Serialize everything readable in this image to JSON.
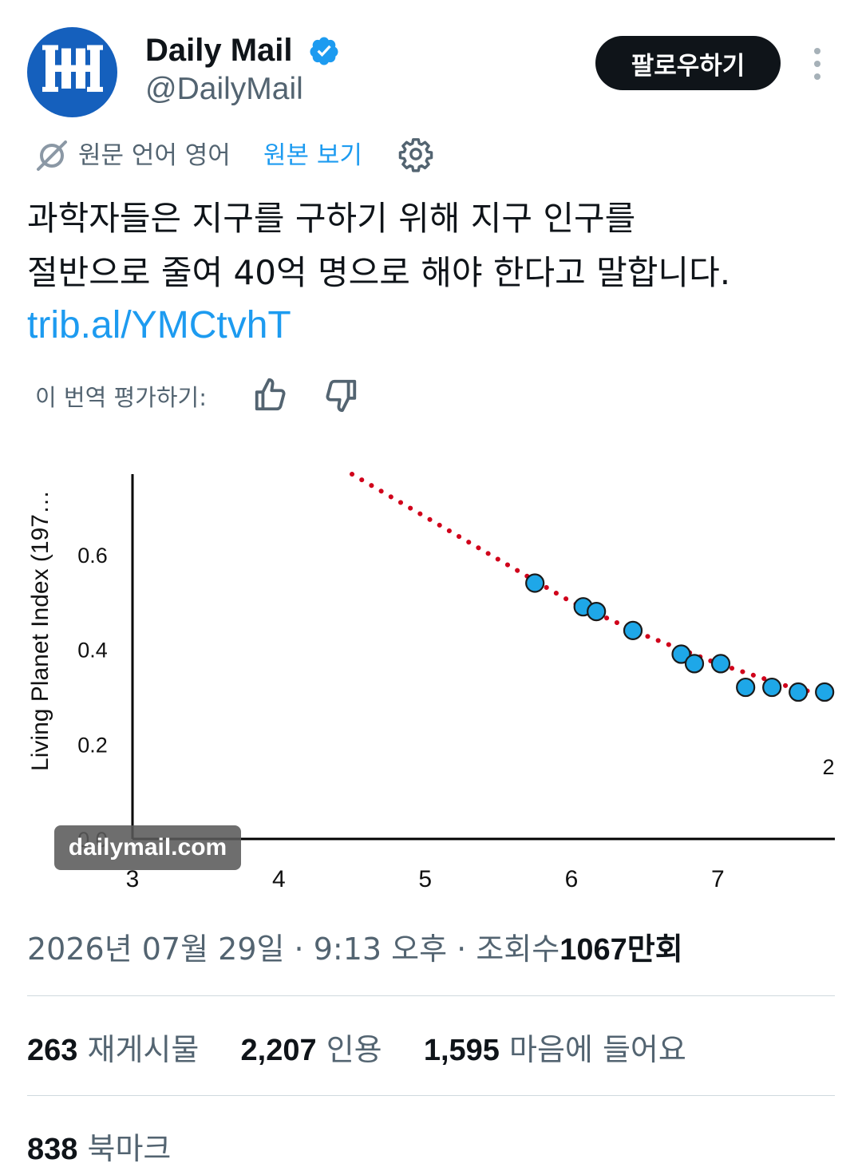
{
  "author": {
    "name": "Daily Mail",
    "handle": "@DailyMail",
    "avatar_letters": "M"
  },
  "header": {
    "follow_label": "팔로우하기"
  },
  "translation": {
    "source_language_label": "원문 언어 영어",
    "show_original_label": "원본 보기"
  },
  "tweet": {
    "text_line1": "과학자들은 지구를 구하기 위해 지구 인구를",
    "text_line2": "절반으로 줄여 40억 명으로 해야 한다고 말합니다.",
    "link": "trib.al/YMCtvhT"
  },
  "rating": {
    "label": "이 번역 평가하기:"
  },
  "media": {
    "watermark": "dailymail.com"
  },
  "chart_data": {
    "type": "scatter",
    "ylabel": "Living Planet Index (197…",
    "y_ticks": [
      "0.0",
      "0.2",
      "0.4",
      "0.6"
    ],
    "x_ticks": [
      "3",
      "4",
      "5",
      "6",
      "7"
    ],
    "xlim": [
      3,
      7.8
    ],
    "ylim": [
      0,
      0.77
    ],
    "cropped_label": "2",
    "points": [
      {
        "x": 5.75,
        "y": 0.54
      },
      {
        "x": 6.08,
        "y": 0.49
      },
      {
        "x": 6.17,
        "y": 0.48
      },
      {
        "x": 6.42,
        "y": 0.44
      },
      {
        "x": 6.75,
        "y": 0.39
      },
      {
        "x": 6.84,
        "y": 0.37
      },
      {
        "x": 7.02,
        "y": 0.37
      },
      {
        "x": 7.19,
        "y": 0.32
      },
      {
        "x": 7.37,
        "y": 0.32
      },
      {
        "x": 7.55,
        "y": 0.31
      },
      {
        "x": 7.73,
        "y": 0.31
      }
    ],
    "trendline": {
      "style": "dotted",
      "color": "#d0021b",
      "points": [
        {
          "x": 4.5,
          "y": 0.77
        },
        {
          "x": 5.0,
          "y": 0.68
        },
        {
          "x": 5.5,
          "y": 0.59
        },
        {
          "x": 6.0,
          "y": 0.5
        },
        {
          "x": 6.5,
          "y": 0.43
        },
        {
          "x": 7.0,
          "y": 0.37
        },
        {
          "x": 7.5,
          "y": 0.32
        },
        {
          "x": 7.8,
          "y": 0.3
        }
      ]
    },
    "point_color": "#1ea7e8",
    "grid": false
  },
  "meta": {
    "date": "2026년 07월 29일",
    "time": "9:13 오후",
    "views_label": "조회수",
    "views_number": "1067",
    "views_unit": "만회"
  },
  "stats": {
    "reposts": {
      "value": "263",
      "label": "재게시물"
    },
    "quotes": {
      "value": "2,207",
      "label": "인용"
    },
    "likes": {
      "value": "1,595",
      "label": "마음에 들어요"
    },
    "bookmarks": {
      "value": "838",
      "label": "북마크"
    }
  },
  "colors": {
    "accent": "#1d9bf0",
    "secondary_text": "#536471",
    "avatar_bg": "#1560bd",
    "follow_bg": "#0f1419"
  }
}
